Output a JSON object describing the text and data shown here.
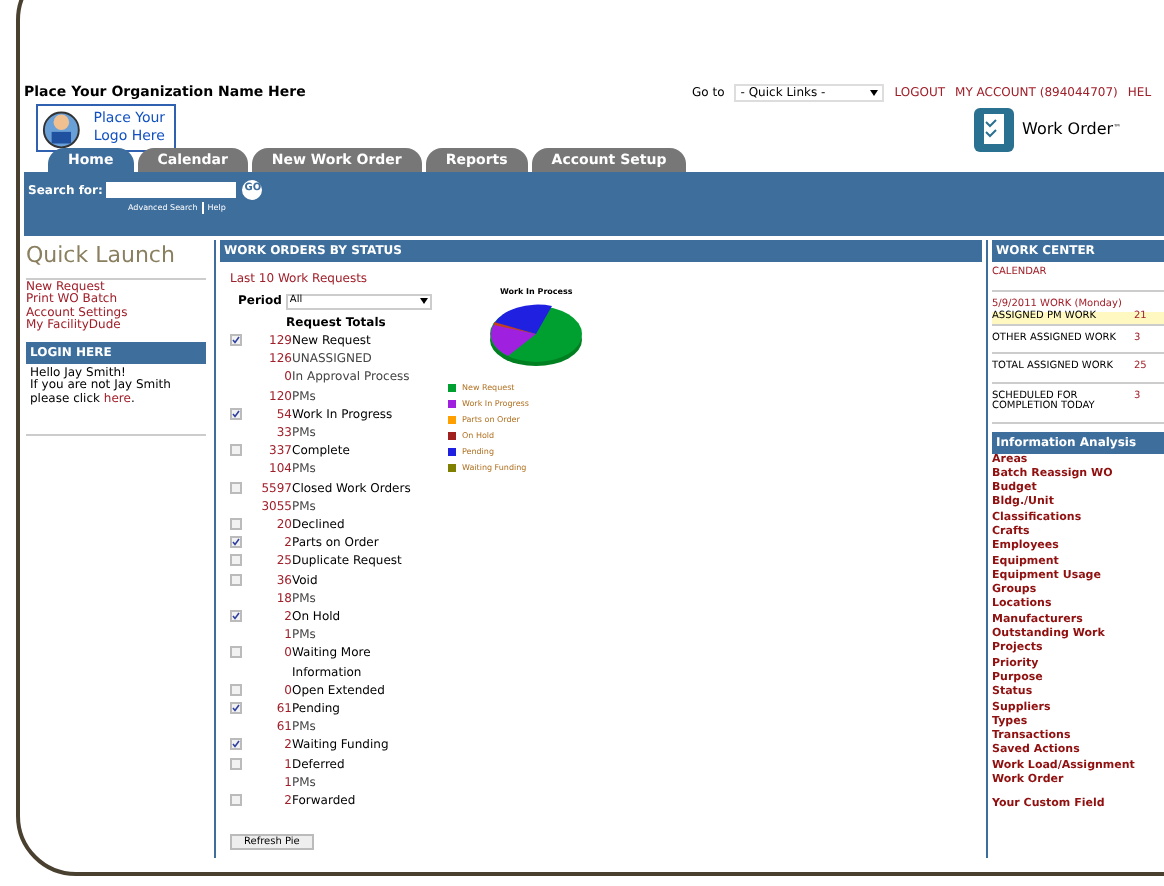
{
  "header": {
    "org_name": "Place Your Organization Name Here",
    "logo_text": "Place Your Logo Here",
    "goto_label": "Go to",
    "quick_links": "- Quick Links -",
    "links": [
      "LOGOUT",
      "MY ACCOUNT (894044707)",
      "HEL"
    ],
    "product": "Work Order",
    "trademark": "™"
  },
  "tabs": [
    {
      "label": "Home",
      "selected": true
    },
    {
      "label": "Calendar",
      "selected": false
    },
    {
      "label": "New Work Order",
      "selected": false
    },
    {
      "label": "Reports",
      "selected": false
    },
    {
      "label": "Account Setup",
      "selected": false
    }
  ],
  "search": {
    "label": "Search for:",
    "button": "GO",
    "links": [
      "Advanced Search",
      "Help"
    ]
  },
  "quick_launch": {
    "title": "Quick Launch",
    "links": [
      "New Request",
      "Print WO Batch",
      "Account Settings",
      "My FacilityDude"
    ]
  },
  "login": {
    "title": "LOGIN HERE",
    "greeting": "Hello Jay Smith!",
    "note": "If you are not Jay Smith please click",
    "link": "here",
    "end": "."
  },
  "work_orders": {
    "title": "WORK ORDERS BY STATUS",
    "last_link": "Last 10 Work Requests",
    "period_label": "Period",
    "period_value": "All",
    "totals_title": "Request Totals",
    "refresh": "Refresh Pie",
    "rows": [
      {
        "kind": "status",
        "checked": true,
        "count": "129",
        "label": "New Request"
      },
      {
        "kind": "sub",
        "count": "126",
        "label": "UNASSIGNED"
      },
      {
        "kind": "sub",
        "count": "0",
        "label": "In Approval Process"
      },
      {
        "kind": "sub",
        "count": "120",
        "label": "PMs"
      },
      {
        "kind": "status",
        "checked": true,
        "count": "54",
        "label": "Work In Progress"
      },
      {
        "kind": "sub",
        "count": "33",
        "label": "PMs"
      },
      {
        "kind": "status",
        "checked": false,
        "count": "337",
        "label": "Complete"
      },
      {
        "kind": "sub",
        "count": "104",
        "label": "PMs"
      },
      {
        "kind": "status",
        "checked": false,
        "count": "5597",
        "label": "Closed Work Orders"
      },
      {
        "kind": "sub",
        "count": "3055",
        "label": "PMs"
      },
      {
        "kind": "status",
        "checked": false,
        "count": "20",
        "label": "Declined"
      },
      {
        "kind": "status",
        "checked": true,
        "count": "2",
        "label": "Parts on Order"
      },
      {
        "kind": "status",
        "checked": false,
        "count": "25",
        "label": "Duplicate Request"
      },
      {
        "kind": "status",
        "checked": false,
        "count": "36",
        "label": "Void"
      },
      {
        "kind": "sub",
        "count": "18",
        "label": "PMs"
      },
      {
        "kind": "status",
        "checked": true,
        "count": "2",
        "label": "On Hold"
      },
      {
        "kind": "sub",
        "count": "1",
        "label": "PMs"
      },
      {
        "kind": "status",
        "checked": false,
        "count": "0",
        "label": "Waiting More Information"
      },
      {
        "kind": "status",
        "checked": false,
        "count": "0",
        "label": "Open Extended"
      },
      {
        "kind": "status",
        "checked": true,
        "count": "61",
        "label": "Pending"
      },
      {
        "kind": "sub",
        "count": "61",
        "label": "PMs"
      },
      {
        "kind": "status",
        "checked": true,
        "count": "2",
        "label": "Waiting Funding"
      },
      {
        "kind": "status",
        "checked": false,
        "count": "1",
        "label": "Deferred"
      },
      {
        "kind": "sub",
        "count": "1",
        "label": "PMs"
      },
      {
        "kind": "status",
        "checked": false,
        "count": "2",
        "label": "Forwarded"
      }
    ],
    "pie_title": "Work In Process",
    "legend": [
      {
        "label": "New Request",
        "color": "#00a030"
      },
      {
        "label": "Work In Progress",
        "color": "#a020e0"
      },
      {
        "label": "Parts on Order",
        "color": "#ffa000"
      },
      {
        "label": "On Hold",
        "color": "#a02020"
      },
      {
        "label": "Pending",
        "color": "#2020e0"
      },
      {
        "label": "Waiting Funding",
        "color": "#808000"
      }
    ]
  },
  "work_center": {
    "title": "WORK CENTER",
    "calendar": "CALENDAR",
    "date_line": "5/9/2011 WORK (Monday)",
    "rows": [
      {
        "label": "ASSIGNED PM WORK",
        "value": "21",
        "highlight": true
      },
      {
        "label": "OTHER ASSIGNED WORK",
        "value": "3",
        "highlight": false
      },
      {
        "label": "TOTAL ASSIGNED WORK",
        "value": "25",
        "highlight": false
      },
      {
        "label": "SCHEDULED FOR COMPLETION TODAY",
        "value": "3",
        "highlight": false
      }
    ]
  },
  "analysis": {
    "title": "Information Analysis",
    "links": [
      "Areas",
      "Batch Reassign WO",
      "Budget",
      "Bldg./Unit",
      "Classifications",
      "Crafts",
      "Employees",
      "Equipment",
      "Equipment Usage",
      "Groups",
      "Locations",
      "Manufacturers",
      "Outstanding Work",
      "Projects",
      "Priority",
      "Purpose",
      "Status",
      "Suppliers",
      "Types",
      "Transactions",
      "Saved Actions",
      "Work Load/Assignment",
      "Work Order"
    ],
    "custom": "Your Custom Field"
  }
}
